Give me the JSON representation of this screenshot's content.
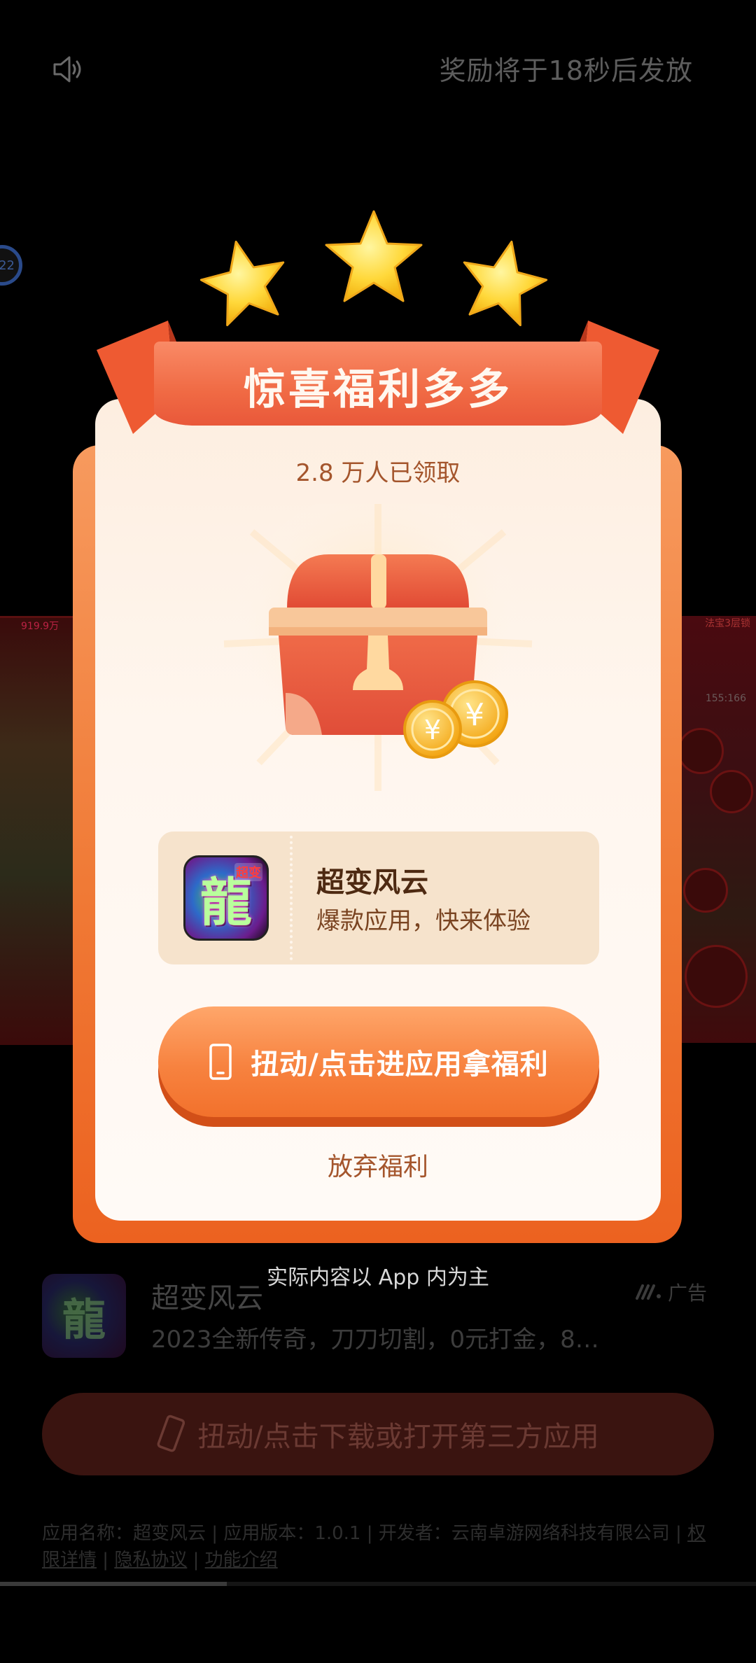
{
  "colors": {
    "overlay": "#000000",
    "modal_orange": "#f07a36",
    "banner_red": "#f06a44",
    "card_cream": "#fff6ee",
    "ticket_tan": "#f6e3cc",
    "accent_brown": "#a4552c",
    "star_yellow": "#ffd83a"
  },
  "top_bar": {
    "sound_icon": "speaker-icon",
    "reward_timer": "奖励将于18秒后发放"
  },
  "side_badge": "22",
  "game_preview": {
    "left_text": "919.9万",
    "right_text": "法宝3层锁",
    "right_coords": "155:166"
  },
  "modal": {
    "banner_title": "惊喜福利多多",
    "claimed_count": "2.8 万人已领取",
    "chest_icon": "treasure-chest-icon",
    "coin_symbol": "¥",
    "app_card": {
      "name": "超变风云",
      "description": "爆款应用，快来体验",
      "icon_glyph": "龍",
      "icon_badge": "超变"
    },
    "cta_label": "扭动/点击进应用拿福利",
    "cta_icon": "phone-icon",
    "give_up_label": "放弃福利"
  },
  "disclaimer": "实际内容以 App 内为主",
  "background_ad": {
    "app_name": "超变风云",
    "app_desc": "2023全新传奇，刀刀切割，0元打金，8…",
    "ad_tag": "广告",
    "icon_glyph": "龍",
    "cta_label": "扭动/点击下载或打开第三方应用",
    "legal": {
      "app_name_label": "应用名称：超变风云",
      "version_label": "应用版本：1.0.1",
      "developer_label": "开发者：云南卓游网络科技有限公司",
      "permissions_link": "权限详情",
      "privacy_link": "隐私协议",
      "features_link": "功能介绍"
    }
  },
  "video_progress": 0.3
}
